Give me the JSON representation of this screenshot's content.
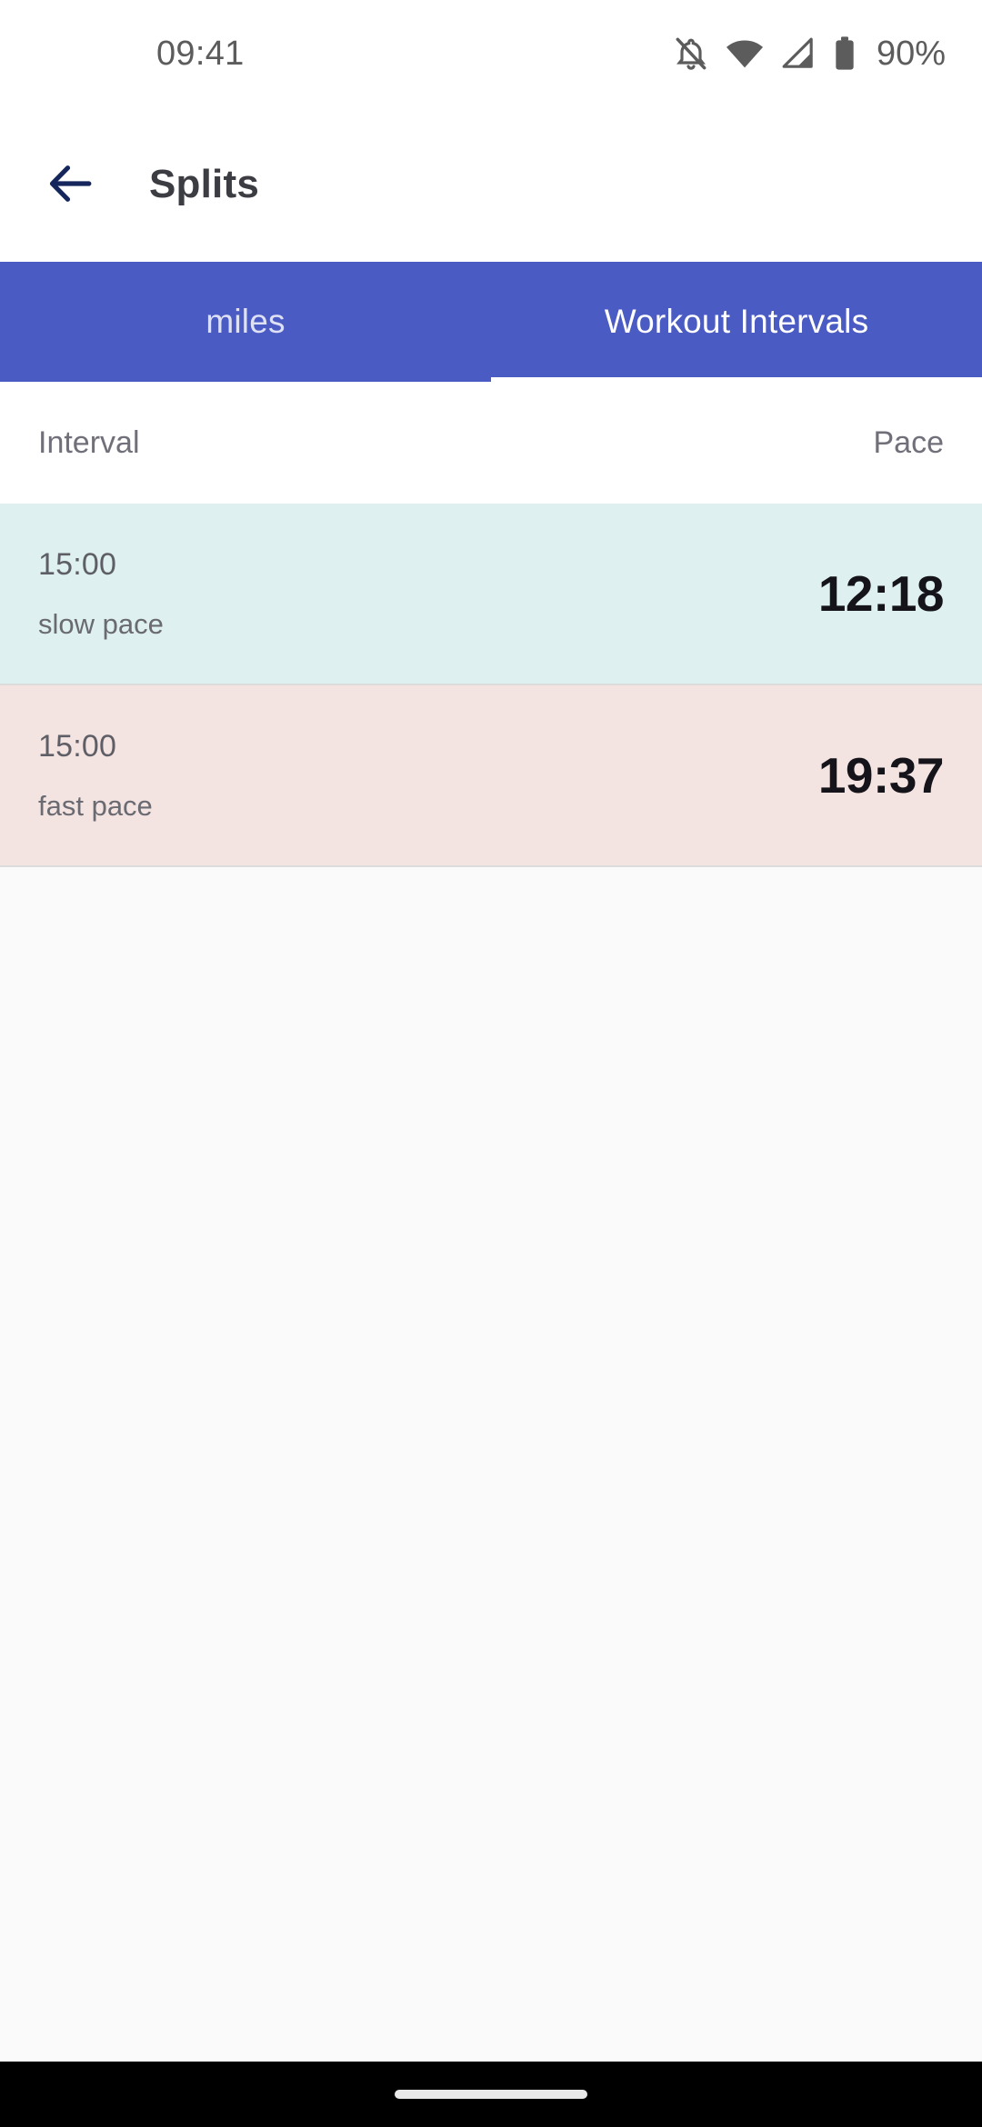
{
  "status_bar": {
    "time": "09:41",
    "battery_percent": "90%",
    "icons": [
      "notifications-off-icon",
      "wifi-icon",
      "cellular-signal-icon",
      "battery-icon"
    ]
  },
  "app_bar": {
    "back_label": "back-arrow",
    "title": "Splits"
  },
  "tabs": [
    {
      "label": "miles",
      "active": false
    },
    {
      "label": "Workout Intervals",
      "active": true
    }
  ],
  "table": {
    "columns": {
      "interval": "Interval",
      "pace": "Pace"
    },
    "rows": [
      {
        "duration": "15:00",
        "label": "slow pace",
        "pace": "12:18",
        "tone": "mint"
      },
      {
        "duration": "15:00",
        "label": "fast pace",
        "pace": "19:37",
        "tone": "pink"
      }
    ]
  },
  "colors": {
    "tab_bar": "#4B5BC4",
    "row_mint": "#DEF0EF",
    "row_pink": "#F4E4E1",
    "back_arrow": "#15265C",
    "title": "#3C3C43",
    "page_background": "#FAFAFA",
    "nav_bar": "#000000"
  }
}
